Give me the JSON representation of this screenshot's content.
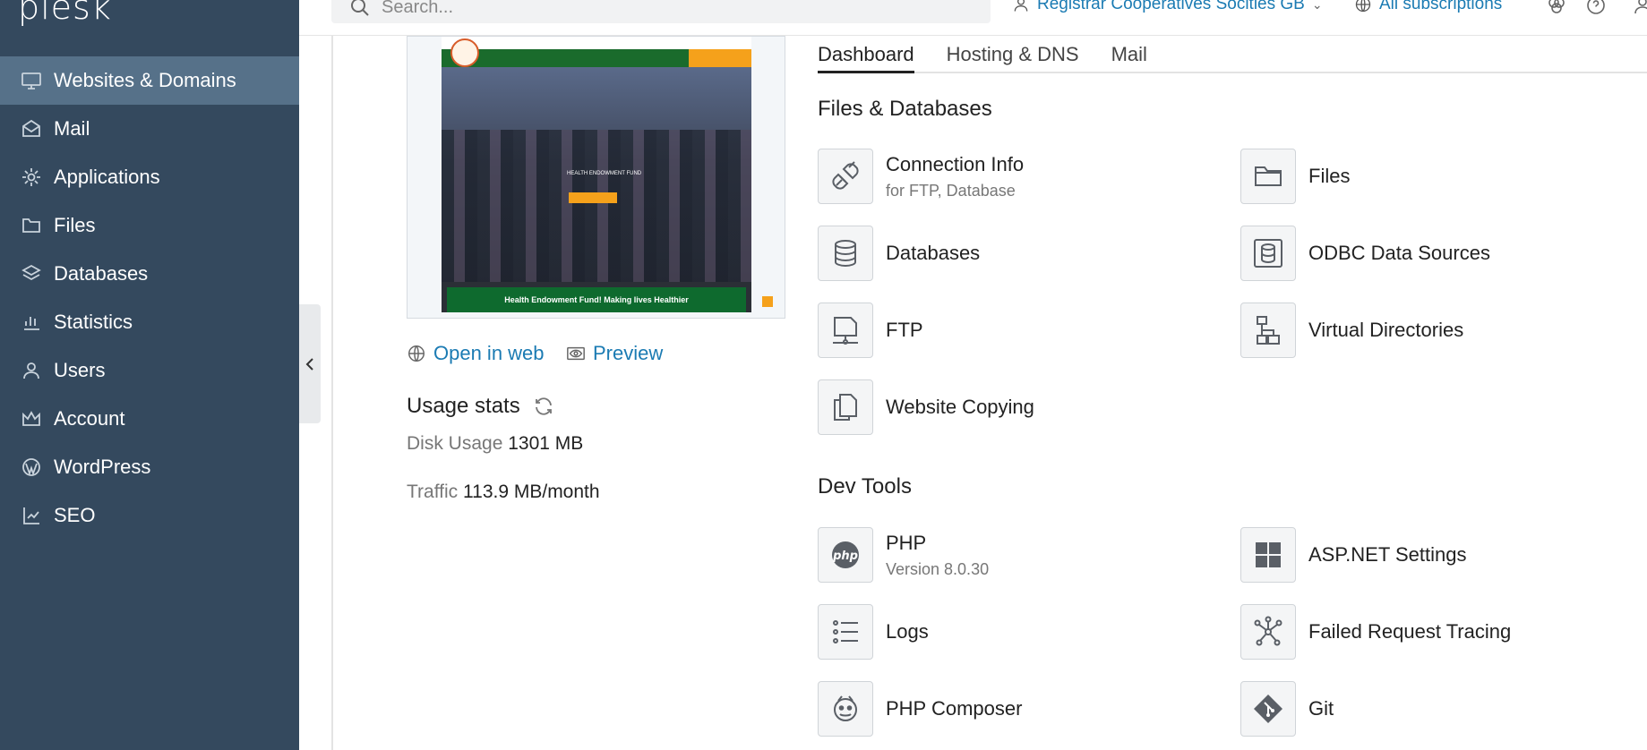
{
  "brand": {
    "logo_text": "plesk"
  },
  "sidebar": {
    "items": [
      {
        "label": "Websites & Domains",
        "icon": "monitor-icon"
      },
      {
        "label": "Mail",
        "icon": "mail-icon"
      },
      {
        "label": "Applications",
        "icon": "gear-icon"
      },
      {
        "label": "Files",
        "icon": "folder-icon"
      },
      {
        "label": "Databases",
        "icon": "layers-icon"
      },
      {
        "label": "Statistics",
        "icon": "bar-chart-icon"
      },
      {
        "label": "Users",
        "icon": "user-icon"
      },
      {
        "label": "Account",
        "icon": "crown-icon"
      },
      {
        "label": "WordPress",
        "icon": "wordpress-icon"
      },
      {
        "label": "SEO",
        "icon": "seo-chart-icon"
      }
    ]
  },
  "topbar": {
    "search_placeholder": "Search...",
    "registrar_label": "Registrar Cooperatives Socities GB",
    "subscriptions_label": "All subscriptions"
  },
  "preview": {
    "footer_text": "Health Endowment Fund! Making lives Healthier",
    "caption": "HEALTH ENDOWMENT FUND"
  },
  "links": {
    "open_in_web": "Open in web",
    "preview": "Preview"
  },
  "usage": {
    "title": "Usage stats",
    "disk_label": "Disk Usage",
    "disk_value": "1301 MB",
    "traffic_label": "Traffic",
    "traffic_value": "113.9 MB/month"
  },
  "tabs": [
    "Dashboard",
    "Hosting & DNS",
    "Mail"
  ],
  "sections": {
    "files_db": {
      "title": "Files & Databases",
      "tools": [
        {
          "name": "Connection Info",
          "sub": "for FTP, Database"
        },
        {
          "name": "Files",
          "sub": ""
        },
        {
          "name": "Databases",
          "sub": ""
        },
        {
          "name": "ODBC Data Sources",
          "sub": ""
        },
        {
          "name": "FTP",
          "sub": ""
        },
        {
          "name": "Virtual Directories",
          "sub": ""
        },
        {
          "name": "Website Copying",
          "sub": ""
        }
      ]
    },
    "dev_tools": {
      "title": "Dev Tools",
      "tools": [
        {
          "name": "PHP",
          "sub": "Version 8.0.30"
        },
        {
          "name": "ASP.NET Settings",
          "sub": ""
        },
        {
          "name": "Logs",
          "sub": ""
        },
        {
          "name": "Failed Request Tracing",
          "sub": ""
        },
        {
          "name": "PHP Composer",
          "sub": ""
        },
        {
          "name": "Git",
          "sub": ""
        }
      ]
    }
  },
  "colors": {
    "sidebar": "#34495e",
    "sidebar_active": "#567189",
    "link": "#1b7bb3"
  }
}
